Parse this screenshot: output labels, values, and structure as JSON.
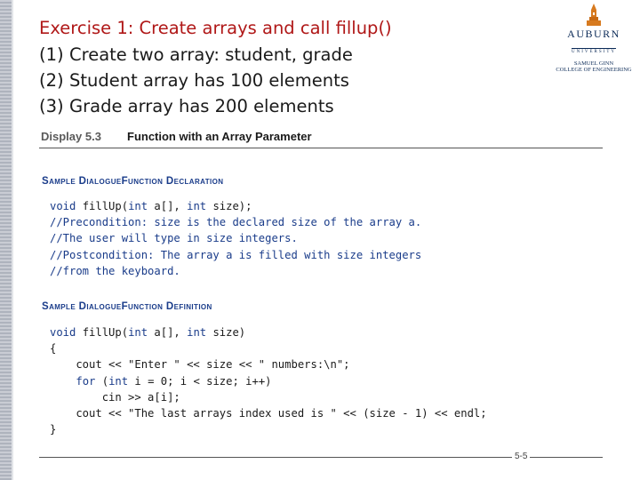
{
  "slide": {
    "title": "Exercise 1: Create arrays and call fillup()",
    "bullets": [
      {
        "num": "(1)",
        "text": "Create two array: student, grade"
      },
      {
        "num": "(2)",
        "text": "Student array has 100  elements"
      },
      {
        "num": "(3)",
        "text": "Grade array has 200 elements"
      }
    ]
  },
  "logo": {
    "name": "AUBURN",
    "university": "UNIVERSITY",
    "line1": "SAMUEL GINN",
    "line2": "COLLEGE OF ENGINEERING"
  },
  "display": {
    "label": "Display 5.3",
    "title": "Function with an Array Parameter"
  },
  "declaration": {
    "heading": "Sample DialogueFunction Declaration",
    "lines": [
      {
        "parts": [
          {
            "t": "void",
            "c": "kw"
          },
          {
            "t": " fillUp(",
            "c": ""
          },
          {
            "t": "int",
            "c": "kw"
          },
          {
            "t": " a[], ",
            "c": ""
          },
          {
            "t": "int",
            "c": "kw"
          },
          {
            "t": " size);",
            "c": ""
          }
        ]
      },
      {
        "parts": [
          {
            "t": "//Precondition: size is the declared size of the array a.",
            "c": "cm"
          }
        ]
      },
      {
        "parts": [
          {
            "t": "//The user will type in size integers.",
            "c": "cm"
          }
        ]
      },
      {
        "parts": [
          {
            "t": "//Postcondition: The array a is filled with size integers",
            "c": "cm"
          }
        ]
      },
      {
        "parts": [
          {
            "t": "//from the keyboard.",
            "c": "cm"
          }
        ]
      }
    ]
  },
  "definition": {
    "heading": "Sample DialogueFunction Definition",
    "lines": [
      {
        "parts": [
          {
            "t": "void",
            "c": "kw"
          },
          {
            "t": " fillUp(",
            "c": ""
          },
          {
            "t": "int",
            "c": "kw"
          },
          {
            "t": " a[], ",
            "c": ""
          },
          {
            "t": "int",
            "c": "kw"
          },
          {
            "t": " size)",
            "c": ""
          }
        ]
      },
      {
        "parts": [
          {
            "t": "{",
            "c": ""
          }
        ]
      },
      {
        "parts": [
          {
            "t": "    cout << \"Enter \" << size << \" numbers:\\n\";",
            "c": ""
          }
        ]
      },
      {
        "parts": [
          {
            "t": "    ",
            "c": ""
          },
          {
            "t": "for",
            "c": "kw"
          },
          {
            "t": " (",
            "c": ""
          },
          {
            "t": "int",
            "c": "kw"
          },
          {
            "t": " i = 0; i < size; i++)",
            "c": ""
          }
        ]
      },
      {
        "parts": [
          {
            "t": "        cin >> a[i];",
            "c": ""
          }
        ]
      },
      {
        "parts": [
          {
            "t": "    cout << \"The last arrays index used is \" << (size - 1) << endl;",
            "c": ""
          }
        ]
      },
      {
        "parts": [
          {
            "t": "}",
            "c": ""
          }
        ]
      }
    ]
  },
  "footer": {
    "page_number": "5-5"
  }
}
